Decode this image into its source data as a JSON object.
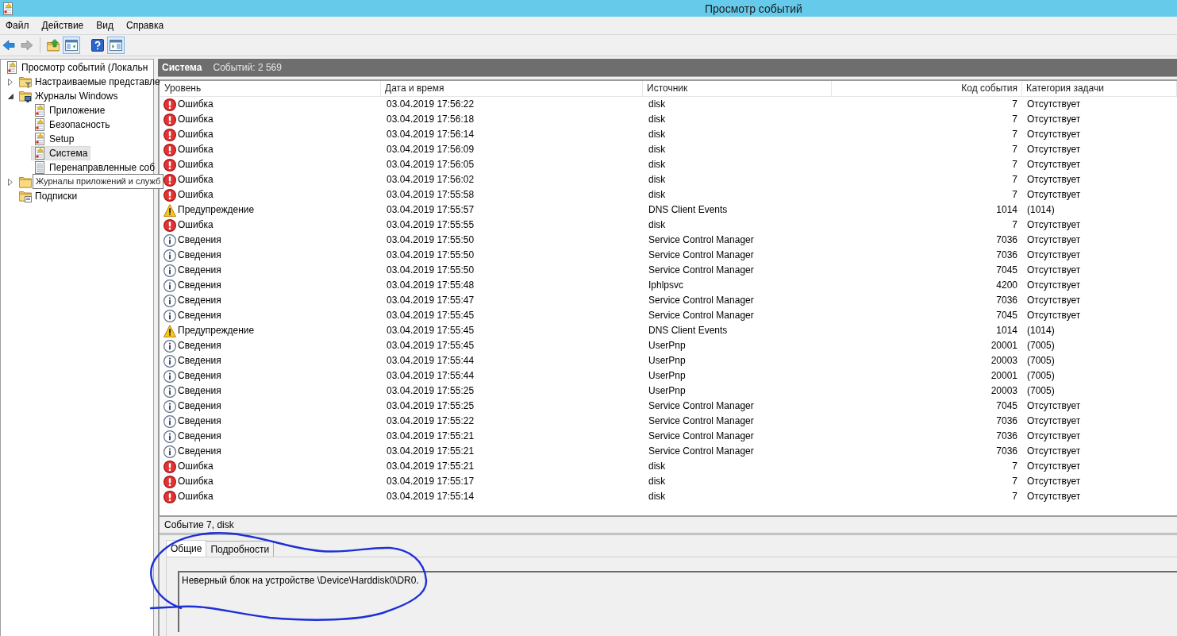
{
  "window": {
    "title": "Просмотр событий"
  },
  "menu": [
    "Файл",
    "Действие",
    "Вид",
    "Справка"
  ],
  "toolbar": [
    {
      "kind": "back",
      "disabled": false,
      "on": false
    },
    {
      "kind": "forward",
      "disabled": true,
      "on": false
    },
    {
      "kind": "separator"
    },
    {
      "kind": "up",
      "disabled": false,
      "on": false
    },
    {
      "kind": "tree-pane",
      "disabled": false,
      "on": true
    },
    {
      "kind": "help",
      "disabled": false,
      "on": false
    },
    {
      "kind": "action-pane",
      "disabled": false,
      "on": true
    }
  ],
  "tree": [
    {
      "label": "Просмотр событий (Локальн",
      "kind": "viewer",
      "selected": false,
      "children": [
        {
          "label": "Настраиваемые представле",
          "kind": "views",
          "expanded": false,
          "selected": false
        },
        {
          "label": "Журналы Windows",
          "kind": "logs",
          "expanded": true,
          "selected": false,
          "children": [
            {
              "label": "Приложение",
              "kind": "log",
              "selected": false
            },
            {
              "label": "Безопасность",
              "kind": "log",
              "selected": false
            },
            {
              "label": "Setup",
              "kind": "log",
              "selected": false
            },
            {
              "label": "Система",
              "kind": "log",
              "selected": true
            },
            {
              "label": "Перенаправленные соб",
              "kind": "forwarded",
              "selected": false
            }
          ]
        },
        {
          "kind": "folder",
          "expanded": false,
          "selected": false,
          "tooltip": "Журналы приложений и служб"
        },
        {
          "label": "Подписки",
          "kind": "subscriptions",
          "selected": false
        }
      ]
    }
  ],
  "log": {
    "title": "Система",
    "count": "Событий: 2 569",
    "columns": [
      "Уровень",
      "Дата и время",
      "Источник",
      "Код события",
      "Категория задачи"
    ],
    "rows": [
      {
        "kind": "error",
        "level": "Ошибка",
        "date": "03.04.2019 17:56:22",
        "source": "disk",
        "event_id": "7",
        "category": "Отсутствует",
        "selected": false
      },
      {
        "kind": "error",
        "level": "Ошибка",
        "date": "03.04.2019 17:56:18",
        "source": "disk",
        "event_id": "7",
        "category": "Отсутствует",
        "selected": false
      },
      {
        "kind": "error",
        "level": "Ошибка",
        "date": "03.04.2019 17:56:14",
        "source": "disk",
        "event_id": "7",
        "category": "Отсутствует",
        "selected": false
      },
      {
        "kind": "error",
        "level": "Ошибка",
        "date": "03.04.2019 17:56:09",
        "source": "disk",
        "event_id": "7",
        "category": "Отсутствует",
        "selected": false
      },
      {
        "kind": "error",
        "level": "Ошибка",
        "date": "03.04.2019 17:56:05",
        "source": "disk",
        "event_id": "7",
        "category": "Отсутствует",
        "selected": false
      },
      {
        "kind": "error",
        "level": "Ошибка",
        "date": "03.04.2019 17:56:02",
        "source": "disk",
        "event_id": "7",
        "category": "Отсутствует",
        "selected": false
      },
      {
        "kind": "error",
        "level": "Ошибка",
        "date": "03.04.2019 17:55:58",
        "source": "disk",
        "event_id": "7",
        "category": "Отсутствует",
        "selected": false
      },
      {
        "kind": "warning",
        "level": "Предупреждение",
        "date": "03.04.2019 17:55:57",
        "source": "DNS Client Events",
        "event_id": "1014",
        "category": "(1014)",
        "selected": false
      },
      {
        "kind": "error",
        "level": "Ошибка",
        "date": "03.04.2019 17:55:55",
        "source": "disk",
        "event_id": "7",
        "category": "Отсутствует",
        "selected": false
      },
      {
        "kind": "info",
        "level": "Сведения",
        "date": "03.04.2019 17:55:50",
        "source": "Service Control Manager",
        "event_id": "7036",
        "category": "Отсутствует",
        "selected": false
      },
      {
        "kind": "info",
        "level": "Сведения",
        "date": "03.04.2019 17:55:50",
        "source": "Service Control Manager",
        "event_id": "7036",
        "category": "Отсутствует",
        "selected": false
      },
      {
        "kind": "info",
        "level": "Сведения",
        "date": "03.04.2019 17:55:50",
        "source": "Service Control Manager",
        "event_id": "7045",
        "category": "Отсутствует",
        "selected": false
      },
      {
        "kind": "info",
        "level": "Сведения",
        "date": "03.04.2019 17:55:48",
        "source": "Iphlpsvc",
        "event_id": "4200",
        "category": "Отсутствует",
        "selected": false
      },
      {
        "kind": "info",
        "level": "Сведения",
        "date": "03.04.2019 17:55:47",
        "source": "Service Control Manager",
        "event_id": "7036",
        "category": "Отсутствует",
        "selected": false
      },
      {
        "kind": "info",
        "level": "Сведения",
        "date": "03.04.2019 17:55:45",
        "source": "Service Control Manager",
        "event_id": "7045",
        "category": "Отсутствует",
        "selected": false
      },
      {
        "kind": "warning",
        "level": "Предупреждение",
        "date": "03.04.2019 17:55:45",
        "source": "DNS Client Events",
        "event_id": "1014",
        "category": "(1014)",
        "selected": false
      },
      {
        "kind": "info",
        "level": "Сведения",
        "date": "03.04.2019 17:55:45",
        "source": "UserPnp",
        "event_id": "20001",
        "category": "(7005)",
        "selected": false
      },
      {
        "kind": "info",
        "level": "Сведения",
        "date": "03.04.2019 17:55:44",
        "source": "UserPnp",
        "event_id": "20003",
        "category": "(7005)",
        "selected": false
      },
      {
        "kind": "info",
        "level": "Сведения",
        "date": "03.04.2019 17:55:44",
        "source": "UserPnp",
        "event_id": "20001",
        "category": "(7005)",
        "selected": false
      },
      {
        "kind": "info",
        "level": "Сведения",
        "date": "03.04.2019 17:55:25",
        "source": "UserPnp",
        "event_id": "20003",
        "category": "(7005)",
        "selected": false
      },
      {
        "kind": "info",
        "level": "Сведения",
        "date": "03.04.2019 17:55:25",
        "source": "Service Control Manager",
        "event_id": "7045",
        "category": "Отсутствует",
        "selected": false
      },
      {
        "kind": "info",
        "level": "Сведения",
        "date": "03.04.2019 17:55:22",
        "source": "Service Control Manager",
        "event_id": "7036",
        "category": "Отсутствует",
        "selected": false
      },
      {
        "kind": "info",
        "level": "Сведения",
        "date": "03.04.2019 17:55:21",
        "source": "Service Control Manager",
        "event_id": "7036",
        "category": "Отсутствует",
        "selected": false
      },
      {
        "kind": "info",
        "level": "Сведения",
        "date": "03.04.2019 17:55:21",
        "source": "Service Control Manager",
        "event_id": "7036",
        "category": "Отсутствует",
        "selected": false
      },
      {
        "kind": "error",
        "level": "Ошибка",
        "date": "03.04.2019 17:55:21",
        "source": "disk",
        "event_id": "7",
        "category": "Отсутствует",
        "selected": false
      },
      {
        "kind": "error",
        "level": "Ошибка",
        "date": "03.04.2019 17:55:17",
        "source": "disk",
        "event_id": "7",
        "category": "Отсутствует",
        "selected": false
      },
      {
        "kind": "error",
        "level": "Ошибка",
        "date": "03.04.2019 17:55:14",
        "source": "disk",
        "event_id": "7",
        "category": "Отсутствует",
        "selected": false
      }
    ]
  },
  "detail": {
    "title": "Событие 7, disk",
    "tabs": [
      {
        "label": "Общие",
        "selected": true
      },
      {
        "label": "Подробности",
        "selected": false
      }
    ],
    "description": "Неверный блок на устройстве \\Device\\Harddisk0\\DR0."
  }
}
